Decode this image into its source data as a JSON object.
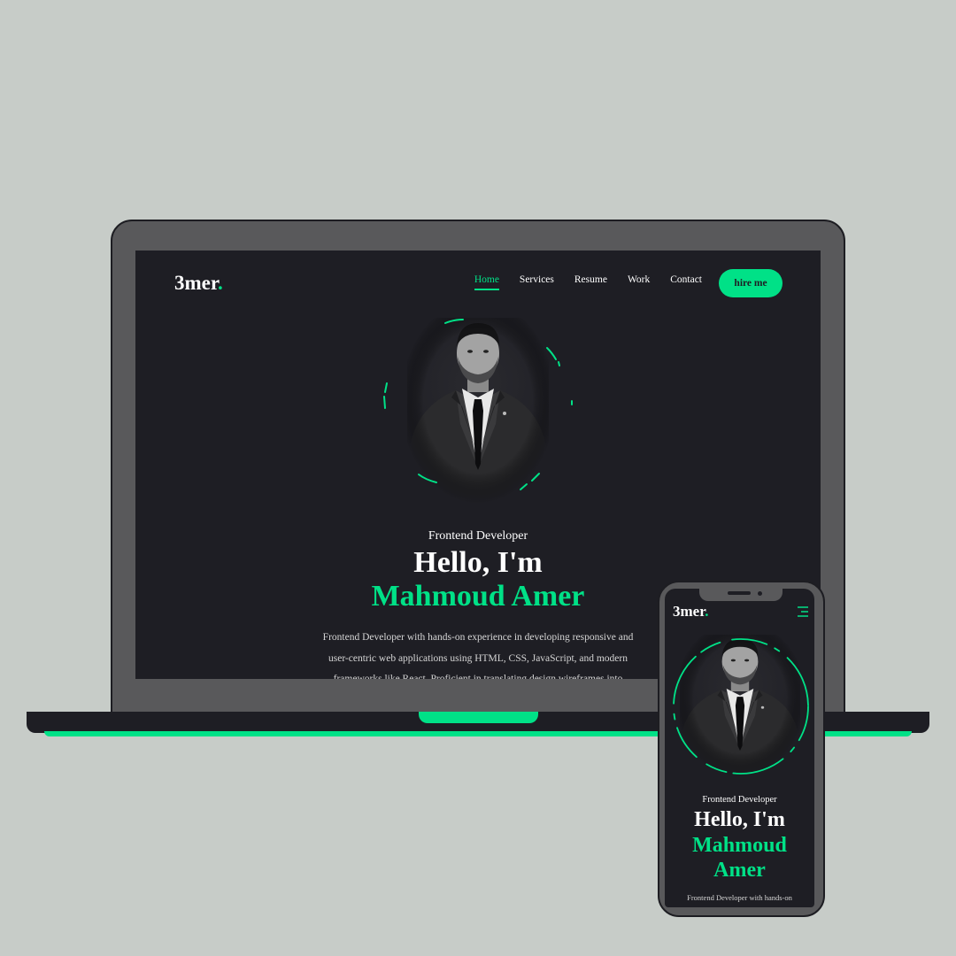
{
  "brand": {
    "name": "3mer",
    "dot": "."
  },
  "nav": {
    "items": [
      "Home",
      "Services",
      "Resume",
      "Work",
      "Contact"
    ],
    "active": "Home"
  },
  "hire_button": "hire me",
  "hero": {
    "role": "Frontend Developer",
    "greeting": "Hello, I'm",
    "name": "Mahmoud Amer",
    "name_line1": "Mahmoud",
    "name_line2": "Amer",
    "description_lines": [
      "Frontend Developer with hands-on experience in developing responsive and",
      "user-centric web applications using HTML, CSS, JavaScript, and modern",
      "frameworks like React. Proficient in translating design wireframes into"
    ],
    "mobile_description": "Frontend Developer with hands-on"
  },
  "colors": {
    "accent": "#00e187",
    "background": "#1e1e24",
    "device_frame": "#59595b",
    "page_bg": "#c7ccc8"
  },
  "icons": {
    "menu": "menu-icon",
    "portrait": "person-photo"
  }
}
